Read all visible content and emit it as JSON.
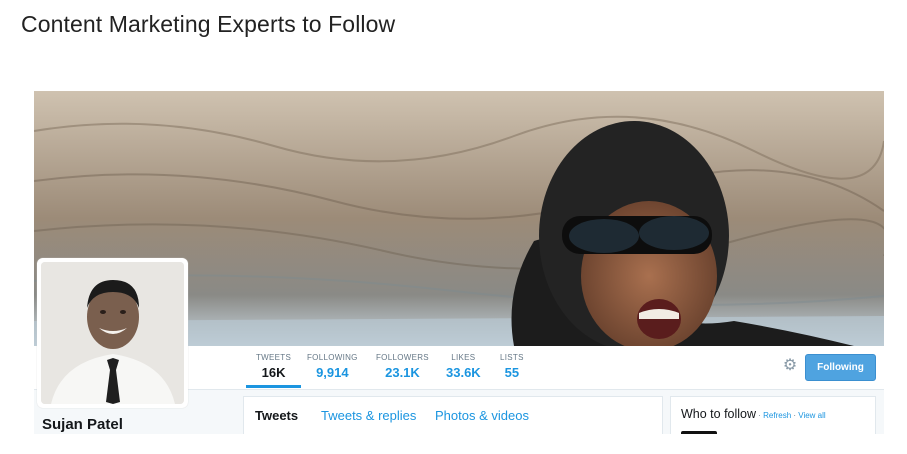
{
  "page": {
    "title": "Content Marketing Experts to Follow"
  },
  "profile": {
    "name": "Sujan Patel",
    "stats": [
      {
        "label": "TWEETS",
        "value": "16K"
      },
      {
        "label": "FOLLOWING",
        "value": "9,914"
      },
      {
        "label": "FOLLOWERS",
        "value": "23.1K"
      },
      {
        "label": "LIKES",
        "value": "33.6K"
      },
      {
        "label": "LISTS",
        "value": "55"
      }
    ],
    "follow_button": "Following"
  },
  "timeline": {
    "tabs": [
      "Tweets",
      "Tweets & replies",
      "Photos & videos"
    ]
  },
  "who_to_follow": {
    "title": "Who to follow",
    "separator1": " · ",
    "refresh": "Refresh",
    "separator2": " · ",
    "view_all": "View all"
  },
  "colors": {
    "accent": "#1b95e0",
    "button": "#4fa3e0"
  },
  "icons": {
    "settings": "gear-icon"
  }
}
